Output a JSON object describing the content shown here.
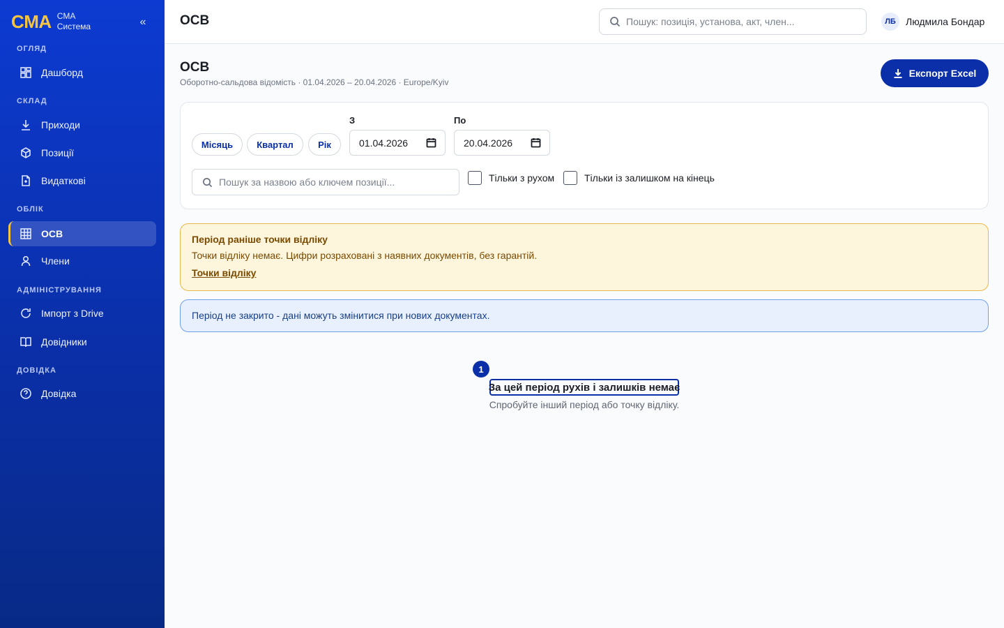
{
  "brand": {
    "logo": "CMA",
    "line1": "CMA",
    "line2": "Система",
    "collapse": "«"
  },
  "sidebar": {
    "sections": {
      "overview": "ОГЛЯД",
      "warehouse": "СКЛАД",
      "accounting": "ОБЛІК",
      "admin": "АДМІНІСТРУВАННЯ",
      "help": "ДОВІДКА"
    },
    "items": [
      {
        "label": "Дашборд",
        "icon": "dashboard-icon"
      },
      {
        "label": "Приходи",
        "icon": "download-icon"
      },
      {
        "label": "Позиції",
        "icon": "box-icon"
      },
      {
        "label": "Видаткові",
        "icon": "document-icon"
      },
      {
        "label": "ОСВ",
        "icon": "table-icon",
        "active": true
      },
      {
        "label": "Члени",
        "icon": "user-icon"
      },
      {
        "label": "Імпорт з Drive",
        "icon": "refresh-icon"
      },
      {
        "label": "Довідники",
        "icon": "book-icon"
      },
      {
        "label": "Довідка",
        "icon": "help-circle-icon"
      }
    ]
  },
  "topbar": {
    "title": "ОСВ",
    "search_placeholder": "Пошук: позиція, установа, акт, член...",
    "user_initials": "ЛБ",
    "user_name": "Людмила Бондар"
  },
  "page": {
    "title": "ОСВ",
    "subtitle": "Оборотно-сальдова відомість · 01.04.2026 – 20.04.2026 · Europe/Kyiv",
    "export_label": "Експорт Excel"
  },
  "filters": {
    "presets": [
      "Місяць",
      "Квартал",
      "Рік"
    ],
    "from_label": "З",
    "from_value": "01.04.2026",
    "to_label": "По",
    "to_value": "20.04.2026",
    "search_placeholder": "Пошук за назвою або ключем позиції...",
    "only_movement": "Тільки з рухом",
    "only_balance": "Тільки із залишком на кінець"
  },
  "alerts": {
    "warning_title": "Період раніше точки відліку",
    "warning_text": "Точки відліку немає. Цифри розраховані з наявних документів, без гарантій.",
    "warning_link": "Точки відліку",
    "info_text": "Період не закрито - дані можуть змінитися при нових документах."
  },
  "empty": {
    "badge": "1",
    "title": "За цей період рухів і залишків немає",
    "subtitle": "Спробуйте інший період або точку відліку."
  },
  "colors": {
    "sidebar": "#0a2fa8",
    "accent": "#0a2fa8",
    "brand": "#f5c542",
    "warning_bg": "#fdf5dc",
    "info_bg": "#e8f0fd"
  }
}
